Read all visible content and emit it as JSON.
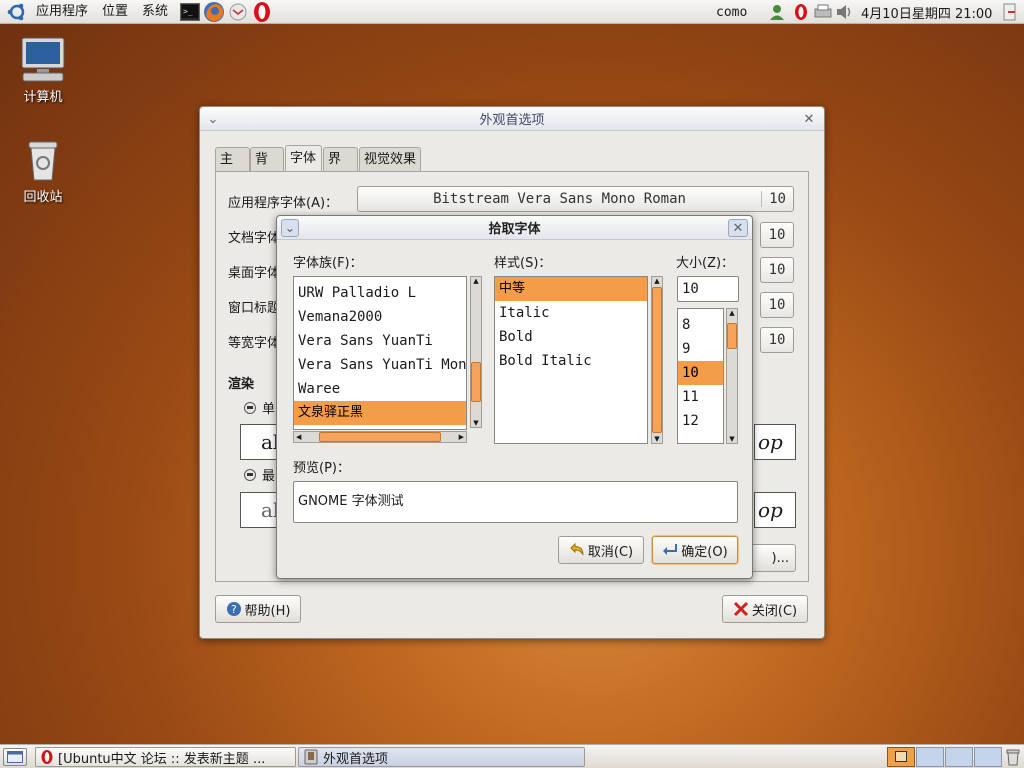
{
  "top_panel": {
    "menus": [
      "应用程序",
      "位置",
      "系统"
    ],
    "username": "como",
    "clock": "4月10日星期四 21:00"
  },
  "desktop": {
    "icons": [
      {
        "label": "计算机"
      },
      {
        "label": "回收站"
      }
    ]
  },
  "appearance": {
    "title": "外观首选项",
    "tabs": [
      "主题",
      "背景",
      "字体",
      "界面",
      "视觉效果"
    ],
    "active_tab": "字体",
    "rows": [
      {
        "label": "应用程序字体(A)：",
        "font": "Bitstream Vera Sans Mono Roman",
        "size": "10"
      },
      {
        "label": "文档字体",
        "size": "10"
      },
      {
        "label": "桌面字体",
        "size": "10"
      },
      {
        "label": "窗口标题",
        "size": "10"
      },
      {
        "label": "等宽字体",
        "size": "10"
      }
    ],
    "rendering_heading": "渲染",
    "rendering_options": [
      "单",
      "最"
    ],
    "sample_left": "ab",
    "sample_right": "op",
    "details_suffix": ")...",
    "help_button": "帮助(H)",
    "close_button": "关闭(C)"
  },
  "font_picker": {
    "title": "拾取字体",
    "family_label": "字体族(F)：",
    "families": [
      "URW Palladio L",
      "Vemana2000",
      "Vera Sans YuanTi",
      "Vera Sans YuanTi Mono",
      "Waree",
      "文泉驿正黑"
    ],
    "selected_family": "文泉驿正黑",
    "style_label": "样式(S)：",
    "styles": [
      "中等",
      "Italic",
      "Bold",
      "Bold Italic"
    ],
    "selected_style": "中等",
    "size_label": "大小(Z)：",
    "size_value": "10",
    "sizes": [
      "8",
      "9",
      "10",
      "11",
      "12"
    ],
    "selected_size": "10",
    "preview_label": "预览(P)：",
    "preview_text": "GNOME 字体测试",
    "cancel_button": "取消(C)",
    "ok_button": "确定(O)"
  },
  "taskbar": {
    "items": [
      {
        "label": "[Ubuntu中文 论坛 :: 发表新主题 ..."
      },
      {
        "label": "外观首选项"
      }
    ]
  },
  "colors": {
    "selection": "#f39c49",
    "accent_title": "#404868"
  }
}
